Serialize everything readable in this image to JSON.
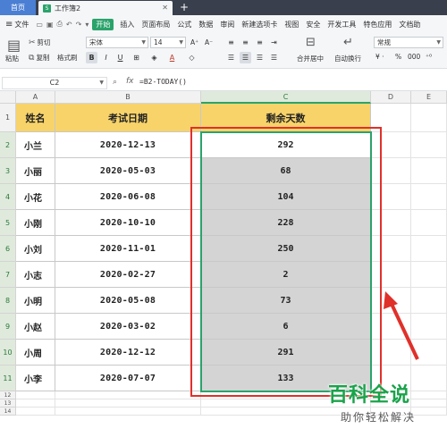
{
  "tabs": {
    "home": "首页",
    "doc": "工作簿2",
    "add": "+"
  },
  "menu": {
    "file": "文件",
    "items": [
      "开始",
      "插入",
      "页面布局",
      "公式",
      "数据",
      "审阅",
      "视图",
      "安全",
      "开发工具",
      "特色应用",
      "文档助"
    ],
    "new_tab": "新建选项卡"
  },
  "ribbon": {
    "cut": "剪切",
    "copy": "复制",
    "format_painter": "格式刷",
    "paste": "粘贴",
    "font": "宋体",
    "size": "14",
    "merge": "合并居中",
    "wrap": "自动换行",
    "number_format": "常规",
    "bold": "B",
    "italic": "I",
    "underline": "U"
  },
  "formula_bar": {
    "cell_ref": "C2",
    "fx": "fx",
    "formula": "=B2-TODAY()"
  },
  "sheet": {
    "columns": [
      "A",
      "B",
      "C",
      "D",
      "E"
    ],
    "header": [
      "姓名",
      "考试日期",
      "剩余天数"
    ],
    "rows": [
      {
        "name": "小兰",
        "date": "2020-12-13",
        "days": "292"
      },
      {
        "name": "小丽",
        "date": "2020-05-03",
        "days": "68"
      },
      {
        "name": "小花",
        "date": "2020-06-08",
        "days": "104"
      },
      {
        "name": "小刚",
        "date": "2020-10-10",
        "days": "228"
      },
      {
        "name": "小刘",
        "date": "2020-11-01",
        "days": "250"
      },
      {
        "name": "小志",
        "date": "2020-02-27",
        "days": "2"
      },
      {
        "name": "小明",
        "date": "2020-05-08",
        "days": "73"
      },
      {
        "name": "小赵",
        "date": "2020-03-02",
        "days": "6"
      },
      {
        "name": "小周",
        "date": "2020-12-12",
        "days": "291"
      },
      {
        "name": "小李",
        "date": "2020-07-07",
        "days": "133"
      }
    ],
    "row_numbers": [
      "1",
      "2",
      "3",
      "4",
      "5",
      "6",
      "7",
      "8",
      "9",
      "10",
      "11",
      "12",
      "13",
      "14"
    ]
  },
  "watermark": {
    "title": "百科全说",
    "subtitle": "助你轻松解决"
  },
  "colors": {
    "header_fill": "#f7d36a",
    "selection": "#2aa36b",
    "highlight_box": "#e0302a",
    "shade": "#d4d4d4"
  }
}
